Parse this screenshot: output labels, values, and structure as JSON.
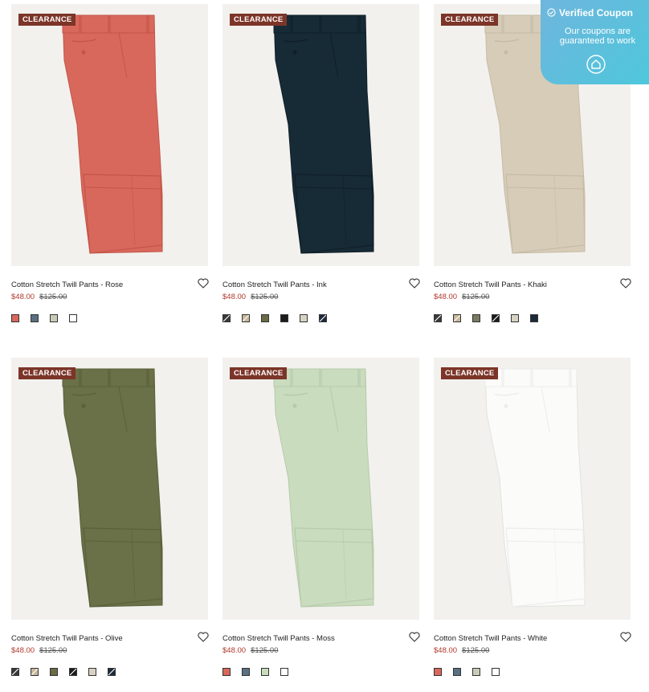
{
  "products": [
    {
      "name": "Cotton Stretch Twill Pants - Rose",
      "badge": "CLEARANCE",
      "price": "$48.00",
      "original_price": "$125.00",
      "color": "#d9685c",
      "shade": "#c35548",
      "swatches": [
        "#d9685c",
        "#5b7082",
        "#c9cbb8",
        "#ffffff"
      ]
    },
    {
      "name": "Cotton Stretch Twill Pants - Ink",
      "badge": "CLEARANCE",
      "price": "$48.00",
      "original_price": "$125.00",
      "color": "#172b36",
      "shade": "#0f1f28",
      "swatches": [
        "pattern-dark",
        "pattern-tan",
        "#6b6b45",
        "#1c1c1c",
        "#d8d2c4",
        "pattern-navy"
      ]
    },
    {
      "name": "Cotton Stretch Twill Pants - Khaki",
      "badge": "CLEARANCE",
      "price": "$48.00",
      "original_price": "$125.00",
      "color": "#d6ccb8",
      "shade": "#c6bba5",
      "swatches": [
        "pattern-dark",
        "pattern-tan",
        "#7a7a62",
        "pattern-black",
        "#d8d2c4",
        "#1d2a3a"
      ]
    },
    {
      "name": "Cotton Stretch Twill Pants - Olive",
      "badge": "CLEARANCE",
      "price": "$48.00",
      "original_price": "$125.00",
      "color": "#6a7047",
      "shade": "#5a603a",
      "swatches": [
        "pattern-dark",
        "pattern-tan",
        "#6b6b45",
        "pattern-black",
        "#d8d2c4",
        "pattern-navy"
      ]
    },
    {
      "name": "Cotton Stretch Twill Pants - Moss",
      "badge": "CLEARANCE",
      "price": "$48.00",
      "original_price": "$125.00",
      "color": "#c9dcbe",
      "shade": "#b6cbaa",
      "swatches": [
        "#d9685c",
        "#5b7082",
        "#c9dcbe",
        "#ffffff"
      ]
    },
    {
      "name": "Cotton Stretch Twill Pants - White",
      "badge": "CLEARANCE",
      "price": "$48.00",
      "original_price": "$125.00",
      "color": "#fbfbfa",
      "shade": "#ececea",
      "swatches": [
        "#d9685c",
        "#5b7082",
        "#c9cbb8",
        "#ffffff"
      ]
    }
  ],
  "coupon": {
    "title": "Verified Coupon",
    "subtitle": "Our coupons are guaranteed to work",
    "icon": "home-icon"
  }
}
